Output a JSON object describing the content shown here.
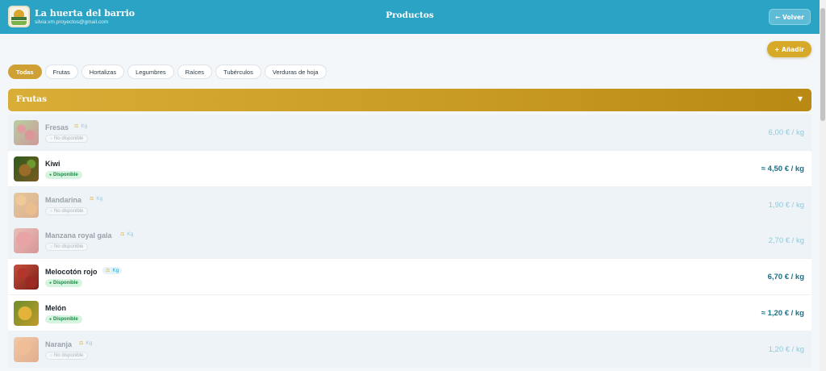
{
  "header": {
    "store_name": "La huerta del barrio",
    "email": "silvia.vm.proyectos@gmail.com",
    "title": "Productos",
    "back_label": "← Volver",
    "color": "#2aa3c5"
  },
  "actions": {
    "add_label": "+ Añadir"
  },
  "filters": [
    {
      "label": "Todas",
      "active": true
    },
    {
      "label": "Frutas",
      "active": false
    },
    {
      "label": "Hortalizas",
      "active": false
    },
    {
      "label": "Legumbres",
      "active": false
    },
    {
      "label": "Raíces",
      "active": false
    },
    {
      "label": "Tubérculos",
      "active": false
    },
    {
      "label": "Verduras de hoja",
      "active": false
    }
  ],
  "category": {
    "title": "Frutas",
    "chevron": "▼",
    "color": "#c79a22"
  },
  "products": [
    {
      "name": "Fresas",
      "unit": "Kg",
      "status": "No disponible",
      "available": false,
      "price": "6,00 € / kg",
      "image": "strawberries-photo"
    },
    {
      "name": "Kiwi",
      "unit": "",
      "status": "Disponible",
      "available": true,
      "price": "≈ 4,50 € / kg",
      "image": "kiwi-photo"
    },
    {
      "name": "Mandarina",
      "unit": "Kg",
      "status": "No disponible",
      "available": false,
      "price": "1,90 € / kg",
      "image": "mandarins-photo"
    },
    {
      "name": "Manzana royal gala",
      "unit": "Kg",
      "status": "No disponible",
      "available": false,
      "price": "2,70 € / kg",
      "image": "apples-photo"
    },
    {
      "name": "Melocotón rojo",
      "unit": "Kg",
      "status": "Disponible",
      "available": true,
      "price": "6,70 € / kg",
      "image": "peaches-photo"
    },
    {
      "name": "Melón",
      "unit": "",
      "status": "Disponible",
      "available": true,
      "price": "≈ 1,20 € / kg",
      "image": "melon-photo"
    },
    {
      "name": "Naranja",
      "unit": "Kg",
      "status": "No disponible",
      "available": false,
      "price": "1,20 € / kg",
      "image": "oranges-photo"
    }
  ]
}
